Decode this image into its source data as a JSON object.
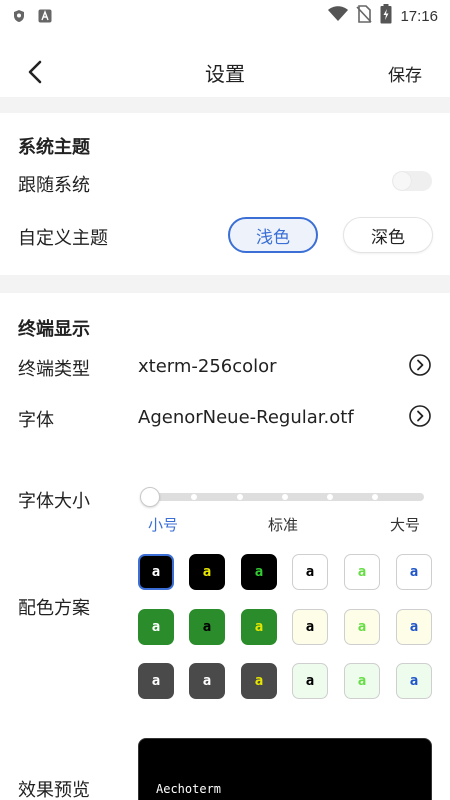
{
  "status_bar": {
    "time": "17:16",
    "icons": [
      "shield-icon",
      "a-badge-icon",
      "wifi-icon",
      "no-sim-icon",
      "battery-charging-icon"
    ]
  },
  "app_bar": {
    "title": "设置",
    "save_label": "保存",
    "back_icon": "chevron-left-icon"
  },
  "theme_section": {
    "title": "系统主题",
    "follow_system_label": "跟随系统",
    "follow_system_on": false,
    "custom_theme_label": "自定义主题",
    "options": [
      "浅色",
      "深色"
    ],
    "selected": "浅色"
  },
  "terminal_section": {
    "title": "终端显示",
    "terminal_type_label": "终端类型",
    "terminal_type_value": "xterm-256color",
    "font_label": "字体",
    "font_value": "AgenorNeue-Regular.otf",
    "font_size_label": "字体大小",
    "font_size_ticks": [
      "小号",
      "标准",
      "大号"
    ],
    "font_size_selected": "小号",
    "color_scheme_label": "配色方案",
    "swatches": [
      [
        {
          "bg": "#000000",
          "fg": "#ffffff",
          "border": "#3b6fd6",
          "char": "a",
          "selected": true
        },
        {
          "bg": "#000000",
          "fg": "#e6e600",
          "border": "#000000",
          "char": "a"
        },
        {
          "bg": "#000000",
          "fg": "#33cc33",
          "border": "#000000",
          "char": "a"
        },
        {
          "bg": "#ffffff",
          "fg": "#000000",
          "border": "#cfcfcf",
          "char": "a"
        },
        {
          "bg": "#ffffff",
          "fg": "#66dd44",
          "border": "#cfcfcf",
          "char": "a"
        },
        {
          "bg": "#ffffff",
          "fg": "#1f55c8",
          "border": "#cfcfcf",
          "char": "a"
        }
      ],
      [
        {
          "bg": "#2a8c2a",
          "fg": "#ffffff",
          "border": "#2a8c2a",
          "char": "a"
        },
        {
          "bg": "#2a8c2a",
          "fg": "#000000",
          "border": "#2a8c2a",
          "char": "a"
        },
        {
          "bg": "#2a8c2a",
          "fg": "#e6e600",
          "border": "#2a8c2a",
          "char": "a"
        },
        {
          "bg": "#fdfde8",
          "fg": "#000000",
          "border": "#cfcfcf",
          "char": "a"
        },
        {
          "bg": "#fdfde8",
          "fg": "#66dd44",
          "border": "#cfcfcf",
          "char": "a"
        },
        {
          "bg": "#fdfde8",
          "fg": "#1f55c8",
          "border": "#cfcfcf",
          "char": "a"
        }
      ],
      [
        {
          "bg": "#4a4a4a",
          "fg": "#ffffff",
          "border": "#4a4a4a",
          "char": "a"
        },
        {
          "bg": "#4a4a4a",
          "fg": "#ffffff",
          "border": "#4a4a4a",
          "char": "a"
        },
        {
          "bg": "#4a4a4a",
          "fg": "#e6e600",
          "border": "#4a4a4a",
          "char": "a"
        },
        {
          "bg": "#eefcee",
          "fg": "#000000",
          "border": "#cfcfcf",
          "char": "a"
        },
        {
          "bg": "#eefcee",
          "fg": "#66dd44",
          "border": "#cfcfcf",
          "char": "a"
        },
        {
          "bg": "#eefcee",
          "fg": "#1f55c8",
          "border": "#cfcfcf",
          "char": "a"
        }
      ]
    ],
    "preview_label": "效果预览",
    "preview_text": "Aechoterm"
  },
  "colors": {
    "accent": "#3b6fd6",
    "divider_band": "#f3f3f3"
  }
}
